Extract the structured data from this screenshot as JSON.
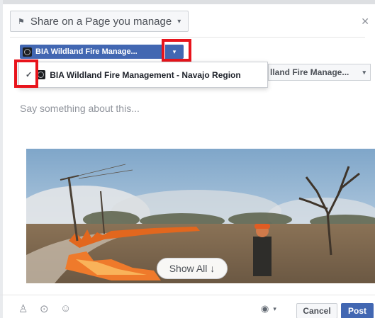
{
  "share": {
    "label": "Share on a Page you manage",
    "flag_icon": "flag-icon",
    "caret": "▾"
  },
  "page_selector": {
    "selected_label": "BIA Wildland Fire Manage...",
    "dropdown_caret": "▾"
  },
  "page_menu": {
    "check": "✓",
    "item_label": "BIA Wildland Fire Management - Navajo Region"
  },
  "second_selector": {
    "label": "lland Fire Manage...",
    "caret": "▾"
  },
  "composer": {
    "placeholder": "Say something about this..."
  },
  "attachment": {
    "show_all": "Show All ↓"
  },
  "footer": {
    "icons": [
      "tag-people-icon",
      "location-icon",
      "emoji-icon"
    ],
    "audience_icon": "globe-icon",
    "audience_caret": "▾",
    "cancel_label": "Cancel",
    "post_label": "Post"
  },
  "colors": {
    "primary_blue": "#4267b2",
    "highlight_red": "#e8141c"
  }
}
